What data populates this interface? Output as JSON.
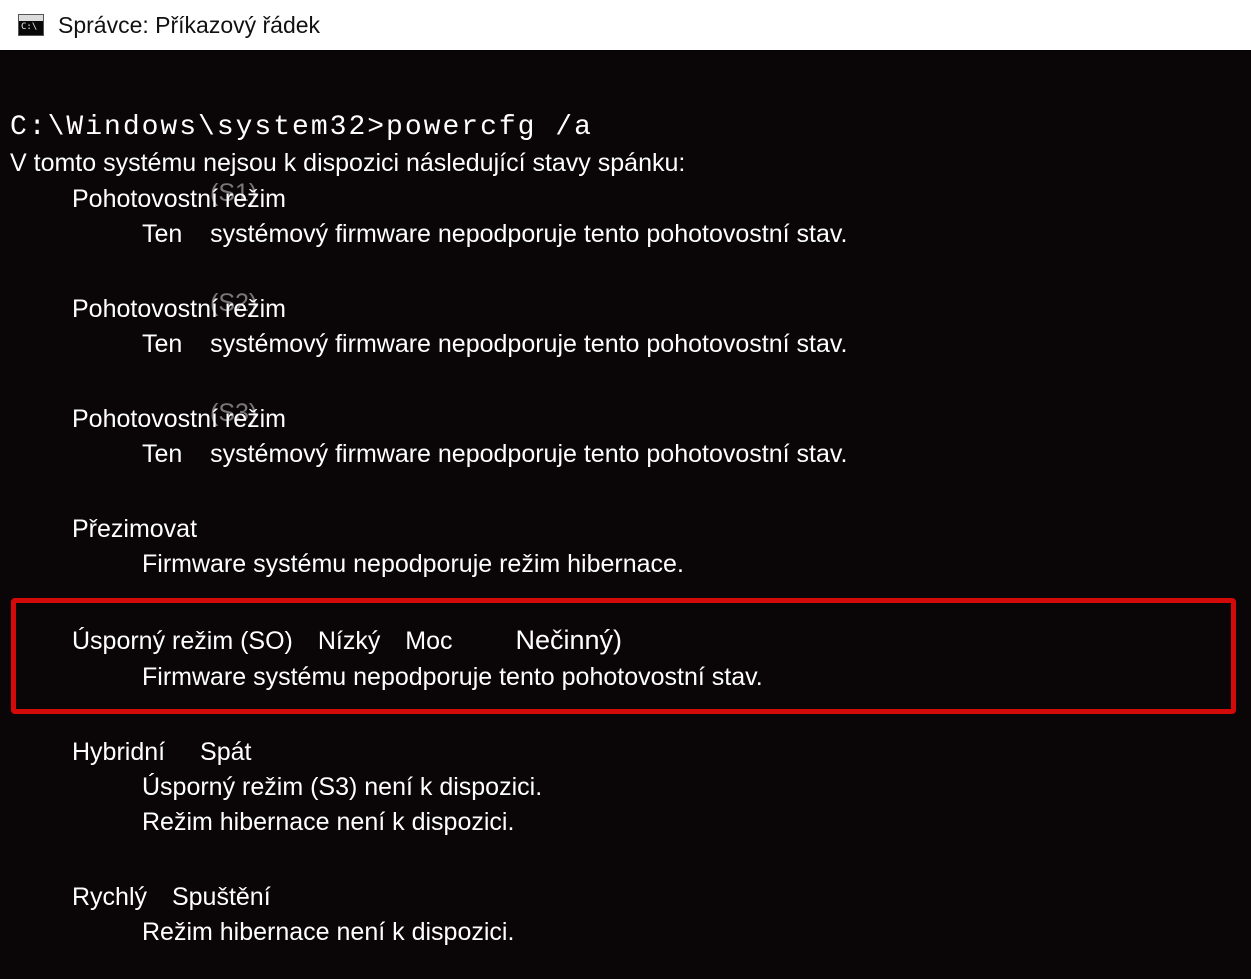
{
  "window": {
    "title": "Správce: Příkazový řádek"
  },
  "prompt": "C:\\Windows\\system32>powercfg /a",
  "intro": "V tomto systému nejsou k dispozici následující stavy spánku:",
  "sections": {
    "s1": {
      "title": "Pohotovostní režim",
      "ghost": "(S1)",
      "lines": [
        "Ten    systémový firmware nepodporuje tento pohotovostní stav."
      ]
    },
    "s2": {
      "title": "Pohotovostní režim",
      "ghost": "(S2)",
      "lines": [
        "Ten    systémový firmware nepodporuje tento pohotovostní stav."
      ]
    },
    "s3": {
      "title": "Pohotovostní režim",
      "ghost": "(S3)",
      "lines": [
        "Ten    systémový firmware nepodporuje tento pohotovostní stav."
      ]
    },
    "hib": {
      "title": "Přezimovat",
      "lines": [
        "Firmware systému nepodporuje režim hibernace."
      ]
    },
    "s0": {
      "title_parts": {
        "p1": "Úsporný režim (SO)",
        "p2": "Nízký",
        "p3": "Moc",
        "p4": "Nečinný)"
      },
      "lines": [
        "Firmware systému nepodporuje tento pohotovostní stav."
      ]
    },
    "hybrid": {
      "title_parts": {
        "p1": "Hybridní",
        "p2": "Spát"
      },
      "lines": [
        "Úsporný režim (S3) není k dispozici.",
        "Režim hibernace není k dispozici."
      ]
    },
    "fast": {
      "title_parts": {
        "p1": "Rychlý",
        "p2": "Spuštění"
      },
      "lines": [
        "Režim hibernace není k dispozici."
      ]
    }
  }
}
